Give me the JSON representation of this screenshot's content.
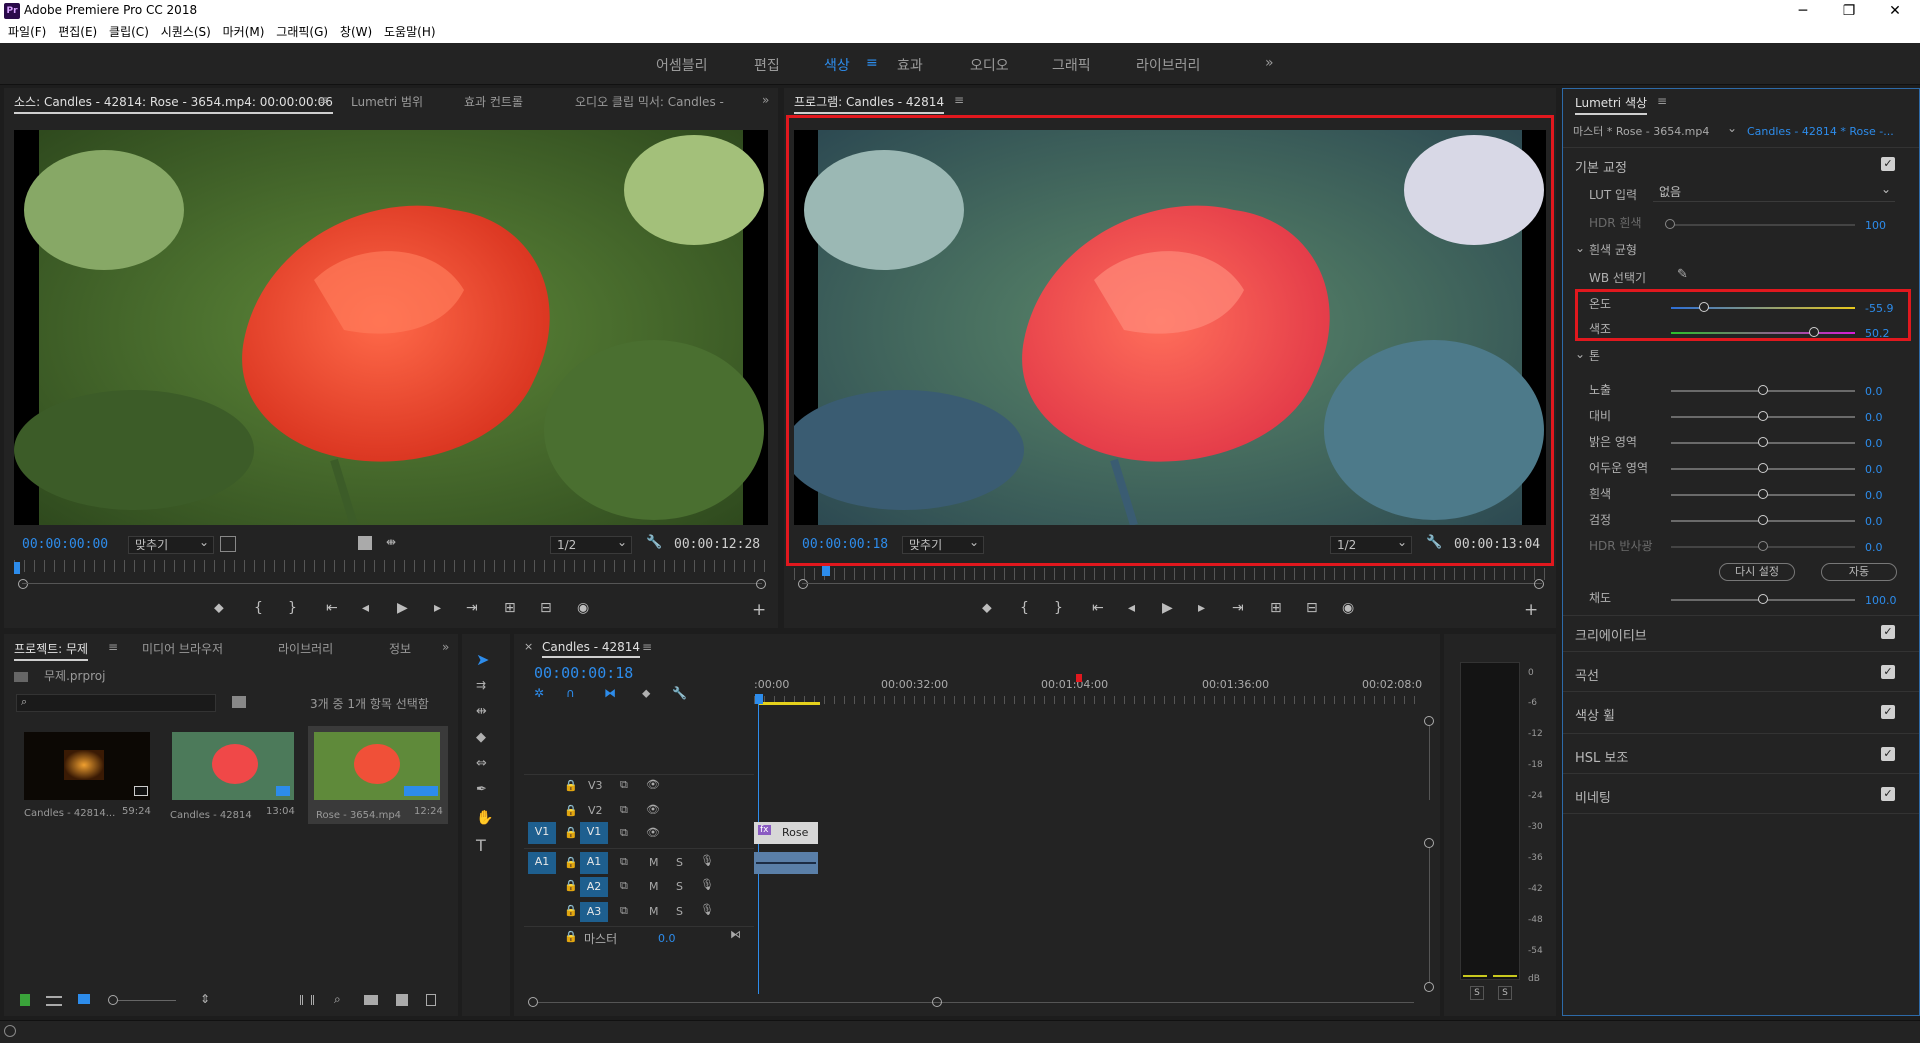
{
  "app": {
    "title": "Adobe Premiere Pro CC 2018",
    "logo": "Pr"
  },
  "window_controls": {
    "minimize": "─",
    "maximize": "❐",
    "close": "✕"
  },
  "menu": [
    "파일(F)",
    "편집(E)",
    "클립(C)",
    "시퀀스(S)",
    "마커(M)",
    "그래픽(G)",
    "창(W)",
    "도움말(H)"
  ],
  "workspaces": [
    {
      "label": "어셈블리"
    },
    {
      "label": "편집"
    },
    {
      "label": "색상",
      "active": true
    },
    {
      "label": "효과"
    },
    {
      "label": "오디오"
    },
    {
      "label": "그래픽"
    },
    {
      "label": "라이브러리"
    }
  ],
  "ws_menu": "≡",
  "ws_more": "»",
  "source": {
    "tabs": [
      "소스: Candles - 42814: Rose - 3654.mp4: 00:00:00:06",
      "Lumetri 범위",
      "효과 컨트롤",
      "오디오 클립 믹서: Candles -"
    ],
    "menu": "≡",
    "more": "»",
    "timecode_in": "00:00:00:00",
    "fit": "맞추기",
    "quality": "1/2",
    "duration": "00:00:12:28"
  },
  "program": {
    "tab": "프로그램: Candles - 42814",
    "menu": "≡",
    "timecode": "00:00:00:18",
    "fit": "맞추기",
    "quality": "1/2",
    "duration": "00:00:13:04"
  },
  "transport_icons": {
    "marker": "⬥",
    "in": "{",
    "out": "}",
    "goto_in": "⇤",
    "step_back": "◂",
    "play": "▶",
    "step_fwd": "▸",
    "goto_out": "⇥",
    "insert": "⊞",
    "overwrite": "⊟",
    "export": "◉",
    "add": "+",
    "wrench": "🔧"
  },
  "project": {
    "tabs": [
      "프로젝트: 무제",
      "미디어 브라우저",
      "라이브러리",
      "정보"
    ],
    "menu": "≡",
    "more": "»",
    "file": "무제.prproj",
    "selection": "3개 중 1개 항목 선택함",
    "items": [
      {
        "name": "Candles - 42814...",
        "dur": "59:24"
      },
      {
        "name": "Candles - 42814",
        "dur": "13:04"
      },
      {
        "name": "Rose - 3654.mp4",
        "dur": "12:24"
      }
    ]
  },
  "timeline": {
    "tab": "Candles - 42814",
    "menu": "≡",
    "close": "×",
    "timecode": "00:00:00:18",
    "ruler": [
      ":00:00",
      "00:00:32:00",
      "00:01:04:00",
      "00:01:36:00",
      "00:02:08:0"
    ],
    "tracks_v": [
      "V3",
      "V2",
      "V1"
    ],
    "tracks_a": [
      "A1",
      "A2",
      "A3"
    ],
    "src_v": "V1",
    "src_a": "A1",
    "mute": "M",
    "solo": "S",
    "master": "마스터",
    "master_val": "0.0",
    "clip_v": "Rose",
    "clip_fx": "fx"
  },
  "meter": {
    "scale": [
      "0",
      "-6",
      "-12",
      "-18",
      "-24",
      "-30",
      "-36",
      "-42",
      "-48",
      "-54",
      "dB"
    ],
    "solo": "S"
  },
  "lumetri": {
    "title": "Lumetri 색상",
    "menu": "≡",
    "master": "마스터 * Rose - 3654.mp4",
    "seq": "Candles - 42814 * Rose -...",
    "basic": "기본 교정",
    "lut_label": "LUT 입력",
    "lut_value": "없음",
    "hdr_label": "HDR 흰색",
    "hdr_value": "100",
    "wb_section": "흰색 균형",
    "wb_picker": "WB 선택기",
    "temp_label": "온도",
    "temp_value": "-55.9",
    "tint_label": "색조",
    "tint_value": "50.2",
    "tone": "톤",
    "tone_rows": [
      {
        "label": "노출",
        "value": "0.0"
      },
      {
        "label": "대비",
        "value": "0.0"
      },
      {
        "label": "밝은 영역",
        "value": "0.0"
      },
      {
        "label": "어두운 영역",
        "value": "0.0"
      },
      {
        "label": "흰색",
        "value": "0.0"
      },
      {
        "label": "검정",
        "value": "0.0"
      },
      {
        "label": "HDR 반사광",
        "value": "0.0"
      }
    ],
    "reset": "다시 설정",
    "auto": "자동",
    "sat_label": "채도",
    "sat_value": "100.0",
    "sections": [
      "크리에이티브",
      "곡선",
      "색상 휠",
      "HSL 보조",
      "비네팅"
    ]
  },
  "colors": {
    "accent": "#2d8ceb",
    "highlight": "#e1181e"
  }
}
